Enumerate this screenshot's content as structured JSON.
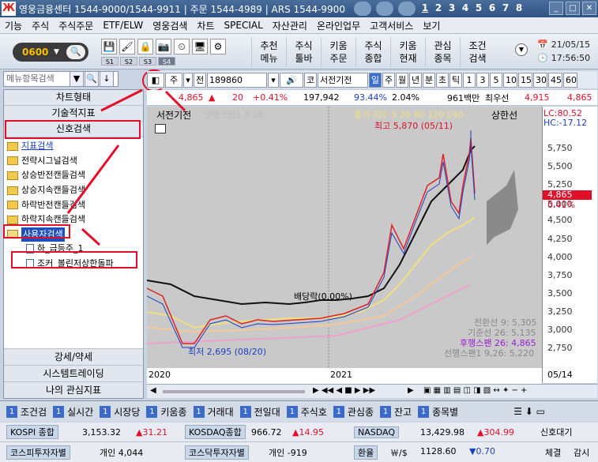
{
  "titlebar": {
    "title": "영웅금융센터 1544-9000/1544-9911 | 주문 1544-4989 | ARS 1544-9900",
    "screens": [
      "1",
      "2",
      "3",
      "4",
      "5",
      "6",
      "7",
      "8"
    ]
  },
  "menu": [
    "기능",
    "주식",
    "주식주문",
    "ETF/ELW",
    "영웅검색",
    "차트",
    "SPECIAL",
    "자산관리",
    "온라인업무",
    "고객서비스",
    "보기"
  ],
  "toolbar": {
    "screen_no": "0600",
    "subtabs": [
      "S1",
      "S2",
      "S3",
      "S4"
    ],
    "buttons": [
      "추천\n메뉴",
      "주식\n툴바",
      "키움\n주문",
      "주식\n종합",
      "키움\n현재",
      "관심\n종목",
      "조건\n검색"
    ],
    "date": "21/05/15",
    "time": "17:56:50"
  },
  "left": {
    "search_placeholder": "메뉴항목검색",
    "header": "차트형태",
    "tab1": "기술적지표",
    "tab2": "신호검색",
    "tree": [
      {
        "label": "지표검색",
        "type": "folder",
        "link": true
      },
      {
        "label": "전략시그널검색",
        "type": "folder"
      },
      {
        "label": "상승반전캔들검색",
        "type": "folder"
      },
      {
        "label": "상승지속캔들검색",
        "type": "folder"
      },
      {
        "label": "하락반전캔들검색",
        "type": "folder"
      },
      {
        "label": "하락지속캔들검색",
        "type": "folder"
      },
      {
        "label": "사용자검색",
        "type": "folder-open",
        "selected": true
      },
      {
        "label": "하_급등주_1",
        "type": "leaf"
      },
      {
        "label": "조커_볼린저상한돌파",
        "type": "leaf"
      }
    ],
    "footer": [
      "강세/약세",
      "시스템트레이딩",
      "나의 관심지표"
    ]
  },
  "codebar": {
    "prefix": "주",
    "jeon": "전",
    "code": "189860",
    "ko": "코",
    "name": "서전기전",
    "periods": [
      "일",
      "주",
      "월",
      "년",
      "분",
      "초",
      "틱"
    ],
    "nums": [
      "1",
      "3",
      "5",
      "10",
      "15",
      "30",
      "45",
      "60"
    ]
  },
  "infobar": {
    "price": "4,865",
    "change": "20",
    "pct": "+0.41%",
    "volume": "197,942",
    "vol_ratio": "93.44%",
    "turnover": "2.04%",
    "amount": "961백만",
    "label": "최우선",
    "ask": "4,915",
    "bid": "4,865"
  },
  "chart_labels": {
    "stock": "서전기전",
    "span": "선행스팬1 9,26",
    "ma_legend": "종가 지수 5 20 60 120 240",
    "upper": "상한선",
    "high": "최고 5,870 (05/11)",
    "low": "최저 2,695 (08/20)",
    "dividend": "배당락(0.00%)",
    "lc": "LC:80.52",
    "hc": "HC:-17.12",
    "price_tag": "4,865",
    "pct_tag": "0.41%",
    "ichi1": "전환선 9: 5,305",
    "ichi2": "기준선 26: 5,135",
    "ichi3": "후행스팬 26: 4,865",
    "ichi4": "선행스팬1 9,26: 5,220",
    "x_2020": "2020",
    "x_2021": "2021",
    "x_end": "05/14"
  },
  "y_ticks": [
    "5,750",
    "5,500",
    "5,250",
    "5,000",
    "4,750",
    "4,500",
    "4,250",
    "4,000",
    "3,750",
    "3,500",
    "3,250",
    "3,000",
    "2,750"
  ],
  "bottomtabs": [
    {
      "n": "1",
      "label": "조건검"
    },
    {
      "n": "1",
      "label": "실시간"
    },
    {
      "n": "1",
      "label": "시장당"
    },
    {
      "n": "1",
      "label": "키움종"
    },
    {
      "n": "1",
      "label": "거래대"
    },
    {
      "n": "1",
      "label": "전일대"
    },
    {
      "n": "1",
      "label": "주식호"
    },
    {
      "n": "1",
      "label": "관심종"
    },
    {
      "n": "1",
      "label": "잔고"
    },
    {
      "n": "1",
      "label": "종목별"
    }
  ],
  "ticker": {
    "kospi_label": "KOSPI 종합",
    "kospi": "3,153.32",
    "kospi_chg": "▲31.21",
    "kosdaq_label": "KOSDAQ종합",
    "kosdaq": "966.72",
    "kosdaq_chg": "▲14.95",
    "nasdaq_label": "NASDAQ",
    "nasdaq": "13,429.98",
    "nasdaq_chg": "▲304.99",
    "signal": "신호대기",
    "kospi_inv": "코스피투자자별",
    "kospi_ind": "개인 4,044",
    "kosdaq_inv": "코스닥투자자별",
    "kosdaq_ind": "개인 -919",
    "fx_label": "환율",
    "fx_unit": "￦/$",
    "fx": "1128.60",
    "fx_chg": "▼0.70",
    "check": "체결",
    "watch": "감시"
  }
}
